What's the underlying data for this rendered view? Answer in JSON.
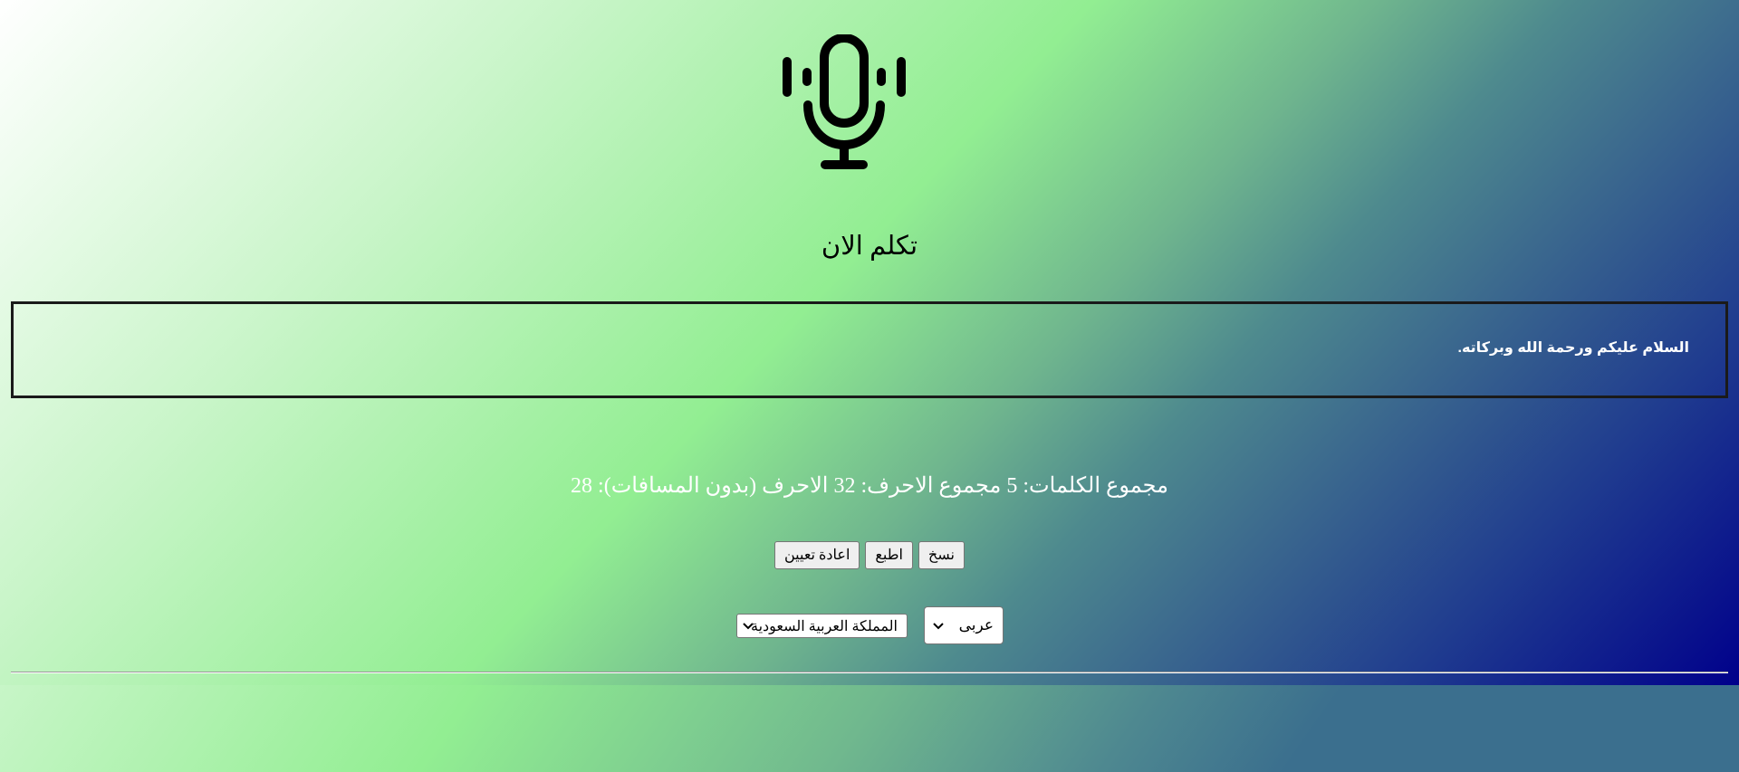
{
  "header": {
    "mic_icon": "microphone-icon",
    "speak_label": "تكلم الان"
  },
  "transcript": {
    "text": "السلام عليكم ورحمة الله وبركاته."
  },
  "stats": {
    "text": "مجموع الكلمات: 5 مجموع الاحرف: 32 الاحرف (بدون المسافات): 28"
  },
  "buttons": {
    "copy_label": "نسخ",
    "print_label": "اطبع",
    "reset_label": "اعادة تعيين"
  },
  "selects": {
    "language_value": "عربى",
    "dialect_value": "المملكة العربية السعودية"
  },
  "colors": {
    "gradient_start": "#ffffff",
    "gradient_mid": "#92ee92",
    "gradient_end": "#00008b"
  }
}
